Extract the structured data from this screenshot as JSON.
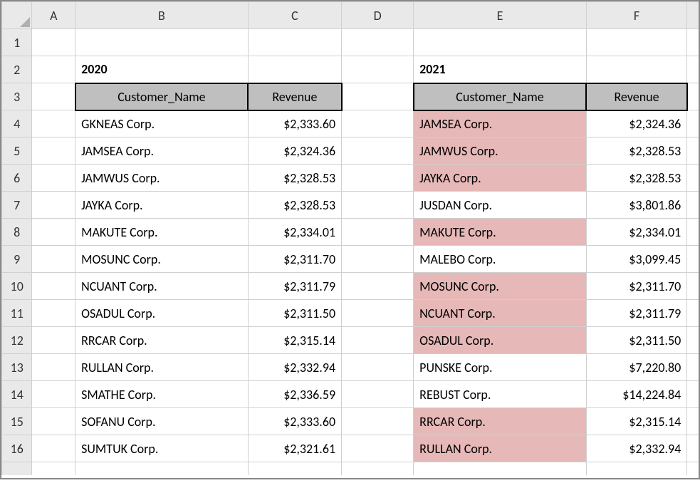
{
  "columns": [
    "A",
    "B",
    "C",
    "D",
    "E",
    "F"
  ],
  "row_numbers": [
    "1",
    "2",
    "3",
    "4",
    "5",
    "6",
    "7",
    "8",
    "9",
    "10",
    "11",
    "12",
    "13",
    "14",
    "15",
    "16"
  ],
  "left": {
    "year": "2020",
    "header_name": "Customer_Name",
    "header_rev": "Revenue",
    "rows": [
      {
        "name": "GKNEAS Corp.",
        "rev": "$2,333.60",
        "hl": false
      },
      {
        "name": "JAMSEA Corp.",
        "rev": "$2,324.36",
        "hl": false
      },
      {
        "name": "JAMWUS Corp.",
        "rev": "$2,328.53",
        "hl": false
      },
      {
        "name": "JAYKA Corp.",
        "rev": "$2,328.53",
        "hl": false
      },
      {
        "name": "MAKUTE Corp.",
        "rev": "$2,334.01",
        "hl": false
      },
      {
        "name": "MOSUNC Corp.",
        "rev": "$2,311.70",
        "hl": false
      },
      {
        "name": "NCUANT Corp.",
        "rev": "$2,311.79",
        "hl": false
      },
      {
        "name": "OSADUL Corp.",
        "rev": "$2,311.50",
        "hl": false
      },
      {
        "name": "RRCAR Corp.",
        "rev": "$2,315.14",
        "hl": false
      },
      {
        "name": "RULLAN Corp.",
        "rev": "$2,332.94",
        "hl": false
      },
      {
        "name": "SMATHE Corp.",
        "rev": "$2,336.59",
        "hl": false
      },
      {
        "name": "SOFANU Corp.",
        "rev": "$2,333.60",
        "hl": false
      },
      {
        "name": "SUMTUK Corp.",
        "rev": "$2,321.61",
        "hl": false
      }
    ]
  },
  "right": {
    "year": "2021",
    "header_name": "Customer_Name",
    "header_rev": "Revenue",
    "rows": [
      {
        "name": "JAMSEA Corp.",
        "rev": "$2,324.36",
        "hl": true
      },
      {
        "name": "JAMWUS Corp.",
        "rev": "$2,328.53",
        "hl": true
      },
      {
        "name": "JAYKA Corp.",
        "rev": "$2,328.53",
        "hl": true
      },
      {
        "name": "JUSDAN Corp.",
        "rev": "$3,801.86",
        "hl": false
      },
      {
        "name": "MAKUTE Corp.",
        "rev": "$2,334.01",
        "hl": true
      },
      {
        "name": "MALEBO Corp.",
        "rev": "$3,099.45",
        "hl": false
      },
      {
        "name": "MOSUNC Corp.",
        "rev": "$2,311.70",
        "hl": true
      },
      {
        "name": "NCUANT Corp.",
        "rev": "$2,311.79",
        "hl": true
      },
      {
        "name": "OSADUL Corp.",
        "rev": "$2,311.50",
        "hl": true
      },
      {
        "name": "PUNSKE Corp.",
        "rev": "$7,220.80",
        "hl": false
      },
      {
        "name": "REBUST Corp.",
        "rev": "$14,224.84",
        "hl": false
      },
      {
        "name": "RRCAR Corp.",
        "rev": "$2,315.14",
        "hl": true
      },
      {
        "name": "RULLAN Corp.",
        "rev": "$2,332.94",
        "hl": true
      }
    ]
  }
}
